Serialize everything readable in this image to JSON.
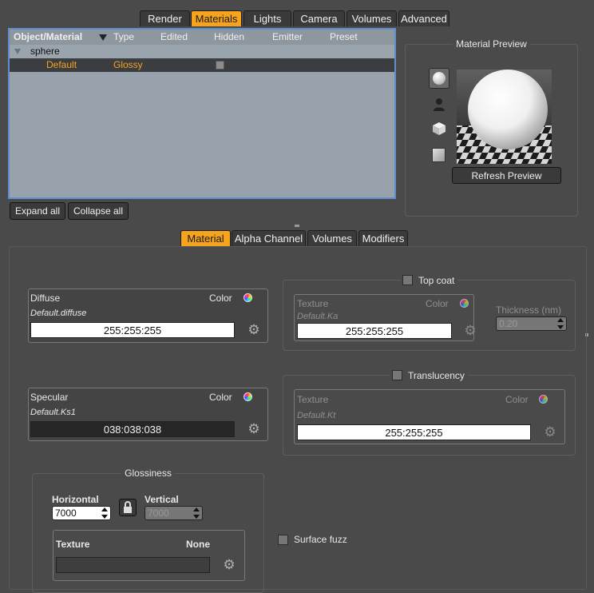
{
  "top_tabs": [
    "Render",
    "Materials",
    "Lights",
    "Camera",
    "Volumes",
    "Advanced"
  ],
  "top_tab_active": "Materials",
  "tree": {
    "columns": [
      "Object/Material",
      "Type",
      "Edited",
      "Hidden",
      "Emitter",
      "Preset"
    ],
    "object": "sphere",
    "row": {
      "material": "Default",
      "type": "Glossy"
    }
  },
  "tree_buttons": {
    "expand": "Expand all",
    "collapse": "Collapse all"
  },
  "preview": {
    "title": "Material Preview",
    "refresh": "Refresh Preview"
  },
  "material_tabs": [
    "Material",
    "Alpha Channel",
    "Volumes",
    "Modifiers"
  ],
  "material_tab_active": "Material",
  "diffuse": {
    "title": "Diffuse",
    "type": "Color",
    "name": "Default.diffuse",
    "value": "255:255:255"
  },
  "specular": {
    "title": "Specular",
    "type": "Color",
    "name": "Default.Ks1",
    "value": "038:038:038"
  },
  "topcoat": {
    "label": "Top coat",
    "texture": "Texture",
    "type": "Color",
    "name": "Default.Ka",
    "value": "255:255:255",
    "thickness_label": "Thickness (nm)",
    "thickness": "0.20"
  },
  "translucency": {
    "label": "Translucency",
    "texture": "Texture",
    "type": "Color",
    "name": "Default.Kt",
    "value": "255:255:255"
  },
  "glossiness": {
    "title": "Glossiness",
    "horizontal_label": "Horizontal",
    "horizontal": "7000",
    "vertical_label": "Vertical",
    "vertical": "7000",
    "texture_label": "Texture",
    "texture_value": "None"
  },
  "surface_fuzz": "Surface fuzz",
  "colors": {
    "accent": "#f6a31d",
    "row_text": "#f6a31d",
    "tree_bg": "#98a2ac"
  }
}
